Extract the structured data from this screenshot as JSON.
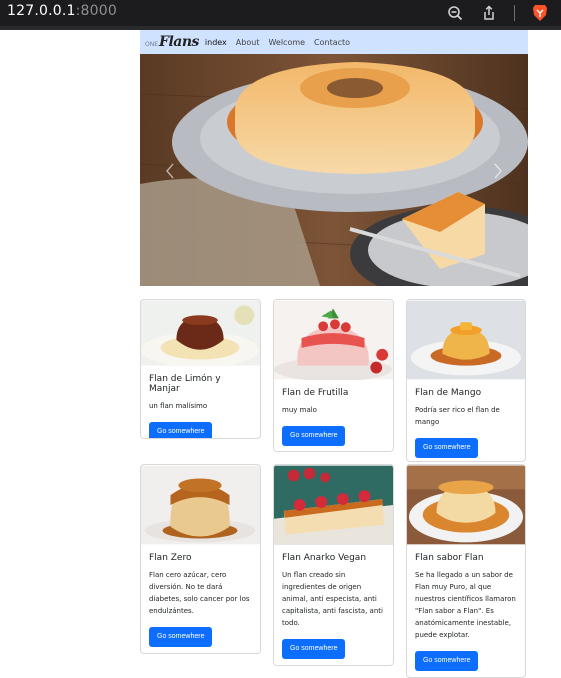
{
  "browser": {
    "url_host": "127.0.0.1",
    "url_port": ":8000",
    "icons": [
      "zoom-out-icon",
      "share-icon",
      "brave-lion-icon"
    ]
  },
  "navbar": {
    "brand_small": "ONE",
    "brand": "Flans",
    "links": [
      {
        "label": "index"
      },
      {
        "label": "About"
      },
      {
        "label": "Welcome"
      },
      {
        "label": "Contacto"
      }
    ]
  },
  "carousel": {
    "prev_icon": "chevron-left-icon",
    "next_icon": "chevron-right-icon"
  },
  "cards": [
    {
      "title": "Flan de Limón y Manjar",
      "text": "un flan malísimo",
      "button": "Go somewhere"
    },
    {
      "title": "Flan de Frutilla",
      "text": "muy malo",
      "button": "Go somewhere"
    },
    {
      "title": "Flan de Mango",
      "text": "Podría ser rico el flan de mango",
      "button": "Go somewhere"
    },
    {
      "title": "Flan Zero",
      "text": "Flan cero azúcar, cero diversión. No te dará diabetes, solo cancer por los endulzántes.",
      "button": "Go somewhere"
    },
    {
      "title": "Flan Anarko Vegan",
      "text": "Un flan creado sin ingredientes de origen animal, anti especista, anti capitalista, anti fascista, anti todo.",
      "button": "Go somewhere"
    },
    {
      "title": "Flan sabor Flan",
      "text": "Se ha llegado a un sabor de Flan muy Puro, al que nuestros científicos llamaron \"Flan sabor a Flan\". Es anatómicamente inestable, puede explotar.",
      "button": "Go somewhere"
    }
  ]
}
